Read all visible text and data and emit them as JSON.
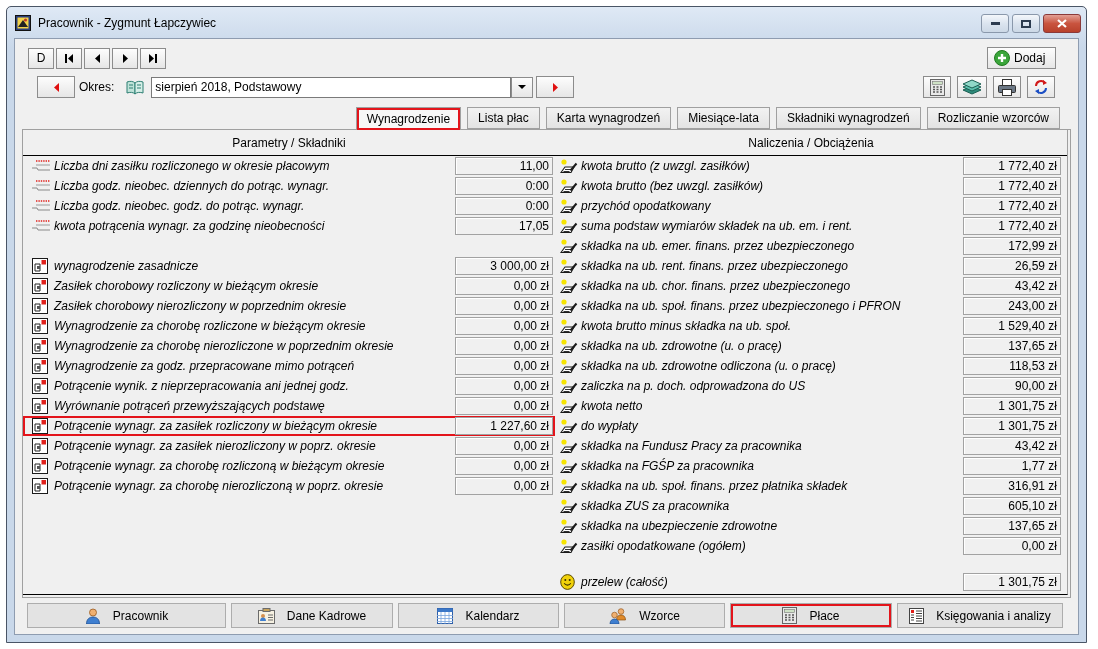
{
  "window": {
    "title": "Pracownik - Zygmunt Łapczywiec"
  },
  "navigation_buttons": [
    {
      "kind": "text",
      "label": "D"
    },
    {
      "kind": "first"
    },
    {
      "kind": "previous"
    },
    {
      "kind": "next"
    },
    {
      "kind": "last"
    }
  ],
  "add_button": {
    "label": "Dodaj"
  },
  "period": {
    "label": "Okres:",
    "value": "sierpień 2018, Podstawowy"
  },
  "tabs": [
    {
      "label": "Wynagrodzenie",
      "selected": true,
      "highlighted": true
    },
    {
      "label": "Lista płac",
      "selected": false,
      "highlighted": false
    },
    {
      "label": "Karta wynagrodzeń",
      "selected": false,
      "highlighted": false
    },
    {
      "label": "Miesiące-lata",
      "selected": false,
      "highlighted": false
    },
    {
      "label": "Składniki wynagrodzeń",
      "selected": false,
      "highlighted": false
    },
    {
      "label": "Rozliczanie wzorców",
      "selected": false,
      "highlighted": false
    }
  ],
  "left_panel": {
    "heading": "Parametry / Składniki",
    "groups": [
      {
        "kind": "parameter",
        "rows": [
          {
            "label": "Liczba dni zasiłku rozliczonego w okresie płacowym",
            "value": "11,00",
            "highlighted": false
          },
          {
            "label": "Liczba godz. nieobec. dziennych do potrąc. wynagr.",
            "value": "0:00",
            "highlighted": false
          },
          {
            "label": "Liczba godz. nieobec. godz. do potrąc. wynagr.",
            "value": "0:00",
            "highlighted": false
          },
          {
            "label": "kwota potrącenia wynagr. za godzinę nieobecności",
            "value": "17,05",
            "highlighted": false
          }
        ]
      },
      {
        "kind": "component",
        "rows": [
          {
            "label": "wynagrodzenie zasadnicze",
            "value": "3 000,00 zł",
            "highlighted": false
          },
          {
            "label": "Zasiłek chorobowy rozliczony w bieżącym okresie",
            "value": "0,00 zł",
            "highlighted": false
          },
          {
            "label": "Zasiłek chorobowy nierozliczony w poprzednim okresie",
            "value": "0,00 zł",
            "highlighted": false
          },
          {
            "label": "Wynagrodzenie za chorobę rozliczone w bieżącym okresie",
            "value": "0,00 zł",
            "highlighted": false
          },
          {
            "label": "Wynagrodzenie za chorobę nierozliczone w poprzednim okresie",
            "value": "0,00 zł",
            "highlighted": false
          },
          {
            "label": "Wynagrodzenie za godz. przepracowane mimo potrąceń",
            "value": "0,00 zł",
            "highlighted": false
          },
          {
            "label": "Potrącenie wynik. z nieprzepracowania ani jednej godz.",
            "value": "0,00 zł",
            "highlighted": false
          },
          {
            "label": "Wyrównanie potrąceń przewyższających podstawę",
            "value": "0,00 zł",
            "highlighted": false
          },
          {
            "label": "Potrącenie wynagr. za zasiłek rozliczony w bieżącym okresie",
            "value": "1 227,60 zł",
            "highlighted": true
          },
          {
            "label": "Potrącenie wynagr. za zasiłek nierozliczony w poprz. okresie",
            "value": "0,00 zł",
            "highlighted": false
          },
          {
            "label": "Potrącenie wynagr. za chorobę rozliczoną w bieżącym okresie",
            "value": "0,00 zł",
            "highlighted": false
          },
          {
            "label": "Potrącenie wynagr. za chorobę nierozliczoną w poprz. okresie",
            "value": "0,00 zł",
            "highlighted": false
          }
        ]
      }
    ]
  },
  "right_panel": {
    "heading": "Naliczenia / Obciążenia",
    "groups": [
      {
        "kind": "charge",
        "rows": [
          {
            "label": "kwota brutto (z uwzgl. zasiłków)",
            "value": "1 772,40 zł",
            "highlighted": false
          },
          {
            "label": "kwota brutto (bez uwzgl. zasiłków)",
            "value": "1 772,40 zł",
            "highlighted": false
          },
          {
            "label": "przychód opodatkowany",
            "value": "1 772,40 zł",
            "highlighted": false
          },
          {
            "label": "suma podstaw wymiarów składek na ub. em. i rent.",
            "value": "1 772,40 zł",
            "highlighted": false
          },
          {
            "label": "składka na ub. emer. finans. przez ubezpieczonego",
            "value": "172,99 zł",
            "highlighted": false
          },
          {
            "label": "składka na ub. rent. finans. przez ubezpieczonego",
            "value": "26,59 zł",
            "highlighted": false
          },
          {
            "label": "składka na ub. chor. finans. przez ubezpieczonego",
            "value": "43,42 zł",
            "highlighted": false
          },
          {
            "label": "składka na ub. społ. finans. przez ubezpieczonego i PFRON",
            "value": "243,00 zł",
            "highlighted": false
          },
          {
            "label": "kwota brutto minus składka na ub. społ.",
            "value": "1 529,40 zł",
            "highlighted": false
          },
          {
            "label": "składka na ub. zdrowotne (u. o pracę)",
            "value": "137,65 zł",
            "highlighted": false
          },
          {
            "label": "składka na ub. zdrowotne odliczona (u. o pracę)",
            "value": "118,53 zł",
            "highlighted": false
          },
          {
            "label": "zaliczka na p. doch. odprowadzona do US",
            "value": "90,00 zł",
            "highlighted": false
          },
          {
            "label": "kwota netto",
            "value": "1 301,75 zł",
            "highlighted": false
          },
          {
            "label": "do wypłaty",
            "value": "1 301,75 zł",
            "highlighted": false
          },
          {
            "label": "składka na Fundusz Pracy za pracownika",
            "value": "43,42 zł",
            "highlighted": false
          },
          {
            "label": "składka na FGŚP za pracownika",
            "value": "1,77 zł",
            "highlighted": false
          },
          {
            "label": "składka na ub. społ. finans. przez płatnika składek",
            "value": "316,91 zł",
            "highlighted": false
          },
          {
            "label": "składka ZUS za pracownika",
            "value": "605,10 zł",
            "highlighted": false
          },
          {
            "label": "składka na ubezpieczenie zdrowotne",
            "value": "137,65 zł",
            "highlighted": false
          },
          {
            "label": "zasiłki opodatkowane (ogółem)",
            "value": "0,00 zł",
            "highlighted": false
          }
        ]
      },
      {
        "kind": "transfer",
        "rows": [
          {
            "label": "przelew (całość)",
            "value": "1 301,75 zł",
            "highlighted": false
          }
        ]
      }
    ]
  },
  "bottom_buttons": [
    {
      "label": "Pracownik",
      "highlighted": false
    },
    {
      "label": "Dane Kadrowe",
      "highlighted": false
    },
    {
      "label": "Kalendarz",
      "highlighted": false
    },
    {
      "label": "Wzorce",
      "highlighted": false
    },
    {
      "label": "Płace",
      "highlighted": true
    },
    {
      "label": "Księgowania i analizy",
      "highlighted": false
    }
  ]
}
